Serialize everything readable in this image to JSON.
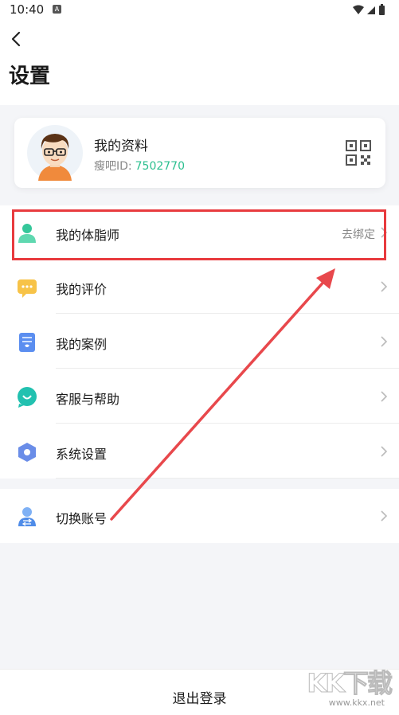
{
  "status_bar": {
    "time": "10:40",
    "notification_letter": "A"
  },
  "header": {
    "title": "设置"
  },
  "profile": {
    "name": "我的资料",
    "id_label": "瘦吧ID:",
    "id_value": "7502770"
  },
  "menu": [
    {
      "label": "我的体脂师",
      "extra": "去绑定",
      "icon": "user-icon"
    },
    {
      "label": "我的评价",
      "extra": "",
      "icon": "comment-icon"
    },
    {
      "label": "我的案例",
      "extra": "",
      "icon": "case-file-icon"
    },
    {
      "label": "客服与帮助",
      "extra": "",
      "icon": "support-chat-icon"
    },
    {
      "label": "系统设置",
      "extra": "",
      "icon": "settings-hexagon-icon"
    }
  ],
  "switch_account": {
    "label": "切换账号",
    "icon": "switch-user-icon"
  },
  "logout": {
    "label": "退出登录"
  },
  "watermark": {
    "logo": "KK下载",
    "url": "www.kkx.net"
  },
  "colors": {
    "accent": "#2bbf8f",
    "annotation": "#e83a3e"
  }
}
